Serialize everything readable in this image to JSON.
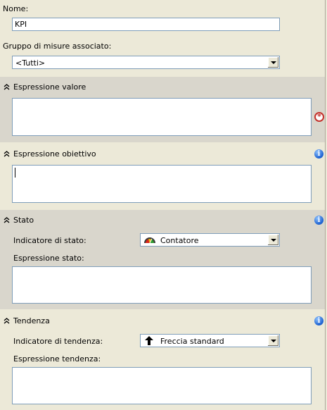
{
  "name": {
    "label": "Nome:",
    "value": "KPI"
  },
  "measure_group": {
    "label": "Gruppo di misure associato:",
    "value": "<Tutti>"
  },
  "value_expression": {
    "header": "Espressione valore"
  },
  "goal_expression": {
    "header": "Espressione obiettivo"
  },
  "status": {
    "header": "Stato",
    "indicator_label": "Indicatore di stato:",
    "indicator_value": "Contatore",
    "indicator_icon": "gauge-icon",
    "expression_label": "Espressione stato:"
  },
  "trend": {
    "header": "Tendenza",
    "indicator_label": "Indicatore di tendenza:",
    "indicator_value": "Freccia standard",
    "indicator_icon": "arrow-up-icon",
    "expression_label": "Espressione tendenza:"
  },
  "colors": {
    "background": "#ece9d8",
    "section": "#d9d6cc",
    "border": "#7f9db9",
    "info": "#1a5fcf",
    "required": "#c4322c"
  }
}
